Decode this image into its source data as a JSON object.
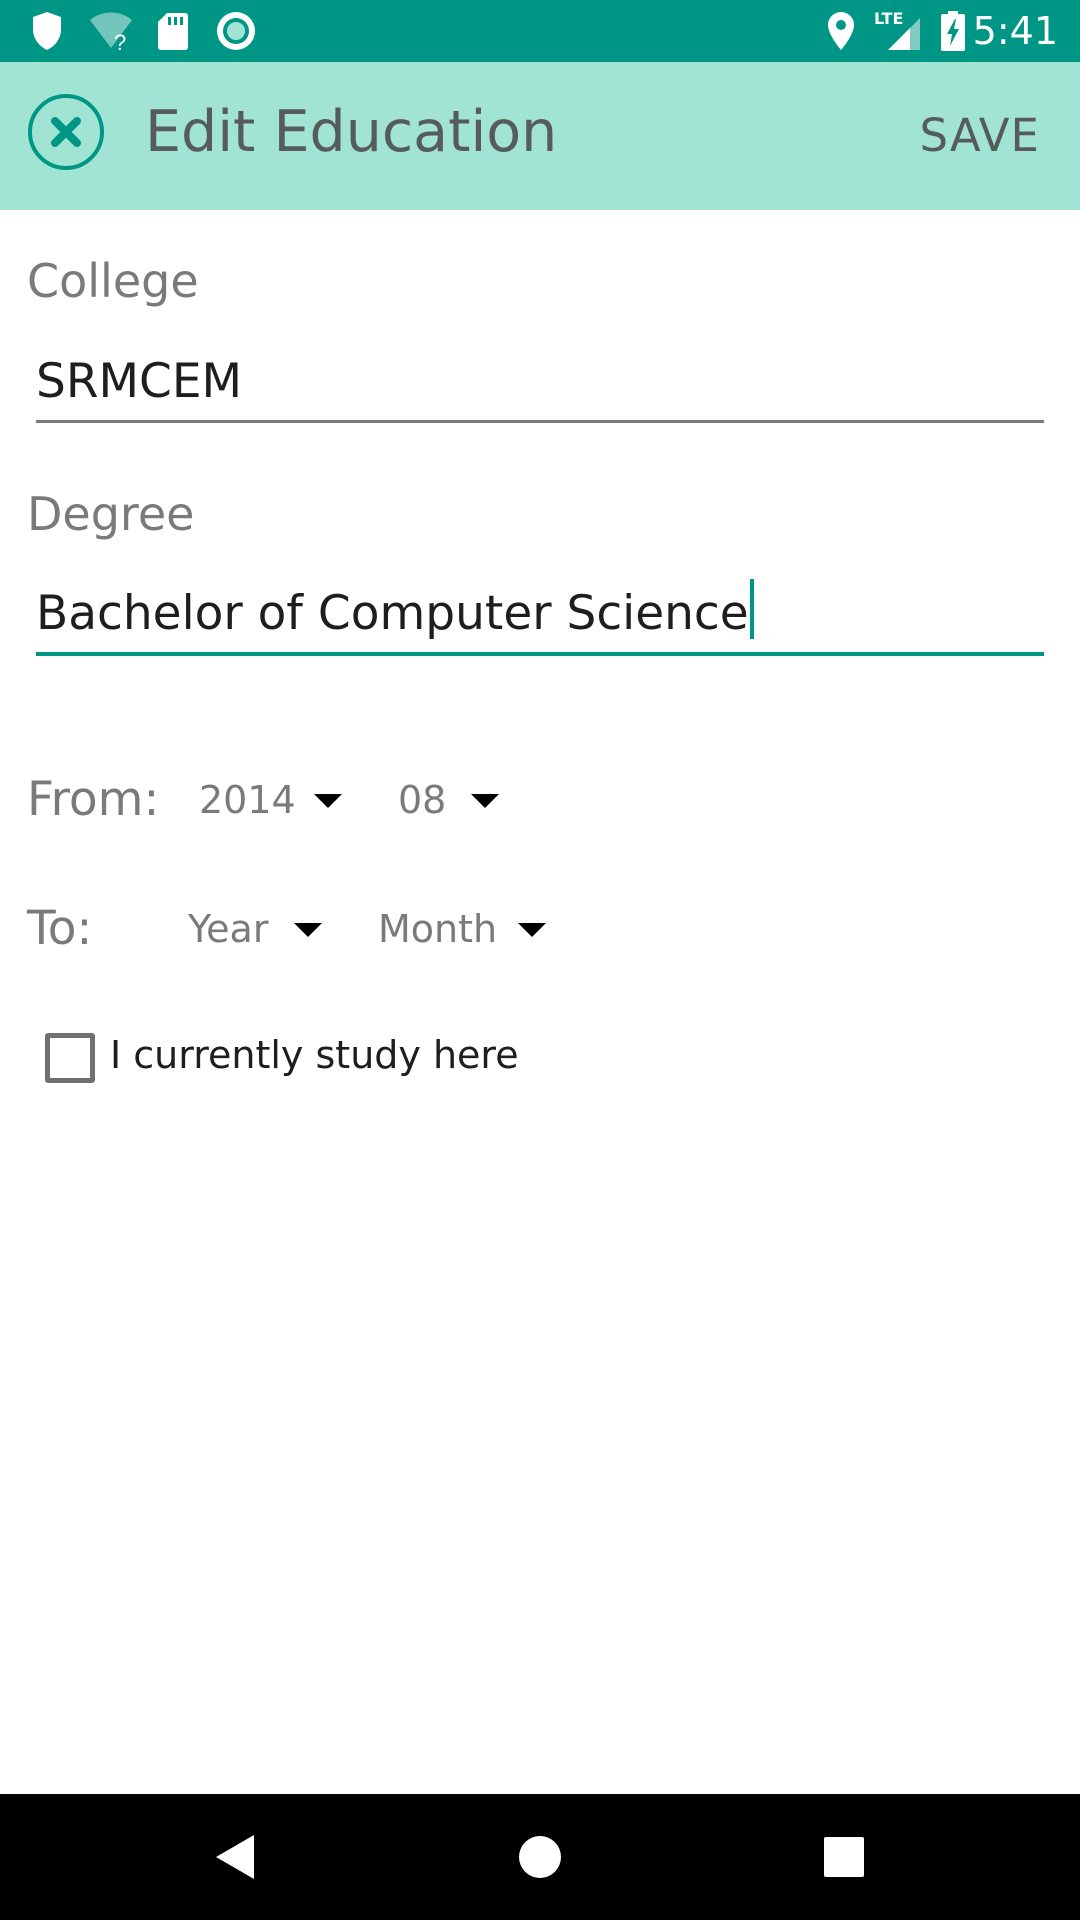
{
  "status_bar": {
    "time": "5:41",
    "network_label": "LTE",
    "icons": [
      "shield-icon",
      "wifi-unknown-icon",
      "sd-card-icon",
      "sync-icon",
      "location-icon",
      "signal-icon",
      "battery-charging-icon"
    ]
  },
  "app_bar": {
    "title": "Edit Education",
    "save_label": "SAVE",
    "close_icon": "close-circle-icon"
  },
  "form": {
    "college": {
      "label": "College",
      "value": "SRMCEM"
    },
    "degree": {
      "label": "Degree",
      "value": "Bachelor of Computer Science"
    },
    "from": {
      "label": "From:",
      "year": "2014",
      "month": "08"
    },
    "to": {
      "label": "To:",
      "year": "Year",
      "month": "Month"
    },
    "currently_studying": {
      "label": "I currently study here",
      "checked": false
    }
  },
  "colors": {
    "status_bar": "#009685",
    "app_bar": "#a2e4d4",
    "accent": "#009685",
    "nav_bar": "#000000"
  },
  "nav_bar": {
    "icons": [
      "back-icon",
      "home-icon",
      "recents-icon"
    ]
  }
}
